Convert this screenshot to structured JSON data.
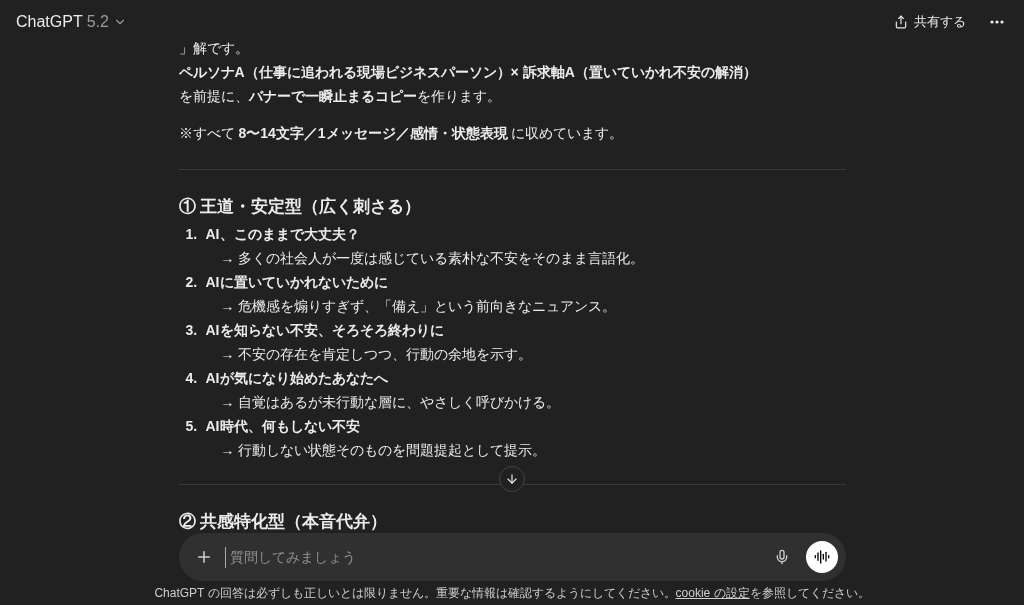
{
  "header": {
    "title": "ChatGPT",
    "version": "5.2",
    "share": "共有する"
  },
  "message": {
    "paragraphs": [
      {
        "kind": "plain",
        "text": "」解です。"
      },
      {
        "kind": "strong",
        "text": "ペルソナA（仕事に追われる現場ビジネスパーソン）× 訴求軸A（置いていかれ不安の解消）"
      },
      {
        "kind": "plain",
        "text": "を前提に、**バナーで一瞬止まるコピー**を作ります。"
      }
    ],
    "note": "※すべて **8〜14文字／1メッセージ／感情・状態表現** に収めています。",
    "sections": [
      {
        "heading": "① 王道・安定型（広く刺さる）",
        "items": [
          {
            "number": "1.",
            "title": "AI、このままで大丈夫？",
            "note": "→ 多くの社会人が一度は感じている素朴な不安をそのまま言語化。"
          },
          {
            "number": "2.",
            "title": "AIに置いていかれないために",
            "note": "→ 危機感を煽りすぎず、「備え」という前向きなニュアンス。"
          },
          {
            "number": "3.",
            "title": "AIを知らない不安、そろそろ終わりに",
            "note": "→ 不安の存在を肯定しつつ、行動の余地を示す。"
          },
          {
            "number": "4.",
            "title": "AIが気になり始めたあなたへ",
            "note": "→ 自覚はあるが未行動な層に、やさしく呼びかける。"
          },
          {
            "number": "5.",
            "title": "AI時代、何もしない不安",
            "note": "→ 行動しない状態そのものを問題提起として提示。"
          }
        ]
      },
      {
        "heading": "② 共感特化型（本音代弁）"
      }
    ]
  },
  "composer": {
    "placeholder": "質問してみましょう"
  },
  "footer": {
    "before": "ChatGPT の回答は必ずしも正しいとは限りません。重要な情報は確認するようにしてください。",
    "link": "cookie の設定",
    "after": "を参照してください。"
  }
}
